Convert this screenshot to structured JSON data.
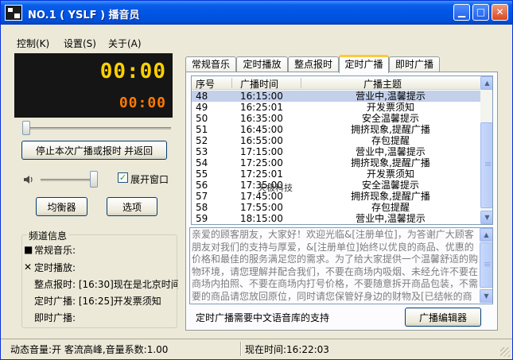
{
  "window": {
    "title": "NO.1 ( YSLF ) 播音员",
    "controls": {
      "minimize": "▁",
      "maximize": "□",
      "close": "✕"
    }
  },
  "menu": [
    "控制(K)",
    "设置(S)",
    "关于(A)"
  ],
  "led": {
    "main_time": "00:00",
    "sub_time": "00:00"
  },
  "buttons": {
    "stop_return": "停止本次广播或报时 并返回",
    "equalizer": "均衡器",
    "options": "选项",
    "broadcast_editor": "广播编辑器"
  },
  "expand_window": {
    "label": "展开窗口",
    "checked": true,
    "mark": "✓"
  },
  "channel_info": {
    "title": "频道信息",
    "lines": [
      {
        "icon": "■",
        "text": "常规音乐:"
      },
      {
        "icon": "✕",
        "text": "定时播放:"
      },
      {
        "icon": "",
        "text": "整点报时: [16:30]现在是北京时间"
      },
      {
        "icon": "",
        "text": "定时广播: [16:25]开发票须知"
      },
      {
        "icon": "",
        "text": "即时广播:"
      }
    ]
  },
  "tabs": [
    {
      "label": "常规音乐",
      "active": false
    },
    {
      "label": "定时播放",
      "active": false
    },
    {
      "label": "整点报时",
      "active": false
    },
    {
      "label": "定时广播",
      "active": true
    },
    {
      "label": "即时广播",
      "active": false
    }
  ],
  "schedule": {
    "columns": [
      "序号",
      "广播时间",
      "广播主题"
    ],
    "rows": [
      {
        "no": "48",
        "time": "16:15:00",
        "topic": "营业中,温馨提示",
        "selected": true
      },
      {
        "no": "49",
        "time": "16:25:01",
        "topic": "开发票须知",
        "selected": false
      },
      {
        "no": "50",
        "time": "16:35:00",
        "topic": "安全温馨提示",
        "selected": false
      },
      {
        "no": "51",
        "time": "16:45:00",
        "topic": "拥挤现象,提醒广播",
        "selected": false
      },
      {
        "no": "52",
        "time": "16:55:00",
        "topic": "存包提醒",
        "selected": false
      },
      {
        "no": "53",
        "time": "17:15:00",
        "topic": "营业中,温馨提示",
        "selected": false
      },
      {
        "no": "54",
        "time": "17:25:00",
        "topic": "拥挤现象,提醒广播",
        "selected": false
      },
      {
        "no": "55",
        "time": "17:25:01",
        "topic": "开发票须知",
        "selected": false
      },
      {
        "no": "56",
        "time": "17:35:00",
        "topic": "安全温馨提示",
        "selected": false
      },
      {
        "no": "57",
        "time": "17:45:00",
        "topic": "拥挤现象,提醒广播",
        "selected": false
      },
      {
        "no": "58",
        "time": "17:55:00",
        "topic": "存包提醒",
        "selected": false
      },
      {
        "no": "59",
        "time": "18:15:00",
        "topic": "营业中,温馨提示",
        "selected": false
      }
    ],
    "scroll_up": "▲",
    "scroll_down": "▼",
    "watermark": "天极科技"
  },
  "message_text": "亲爱的顾客朋友，大家好！欢迎光临&[注册单位]，为答谢广大顾客朋友对我们的支持与厚爱，&[注册单位]始终以优良的商品、优惠的价格和最佳的服务满足您的需求。为了给大家提供一个温馨舒适的购物环境，请您理解并配合我们，不要在商场内吸烟、未经允许不要在商场内拍照、不要在商场内打号价格，不要随意拆开商品包装，不需要的商品请您放回原位，同时请您保管好身边的财物及[已结帐的商品]。如果您对我们的商品",
  "tts_note": "定时广播需要中文语音库的支持",
  "statusbar": {
    "left": "动态音量:开 客流高峰,音量系数:1.00",
    "right": "现在时间:16:22:03"
  }
}
